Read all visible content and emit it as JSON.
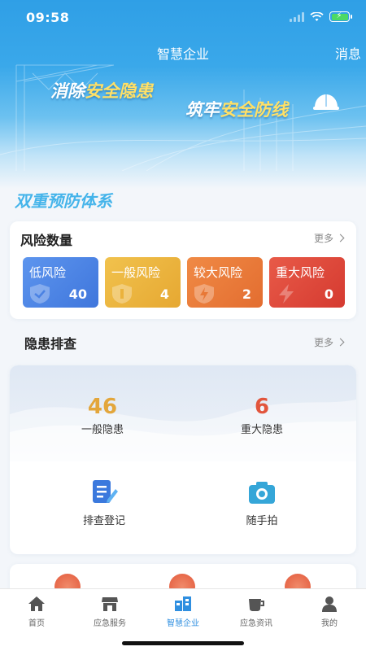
{
  "status_bar": {
    "time": "09:58"
  },
  "nav": {
    "title": "智慧企业",
    "message": "消息"
  },
  "banner": {
    "slogan1_prefix": "消除",
    "slogan1_highlight": "安全隐患",
    "slogan2_prefix": "筑牢",
    "slogan2_highlight": "安全防线"
  },
  "section_heading": "双重预防体系",
  "risk": {
    "title": "风险数量",
    "more": "更多",
    "tiles": [
      {
        "label": "低风险",
        "count": "40",
        "color": "#4f86e6",
        "icon": "shield-check-icon"
      },
      {
        "label": "一般风险",
        "count": "4",
        "color": "#edb63c",
        "icon": "shield-icon"
      },
      {
        "label": "较大风险",
        "count": "2",
        "color": "#ea7c3c",
        "icon": "lightning-shield-icon"
      },
      {
        "label": "重大风险",
        "count": "0",
        "color": "#e04a3c",
        "icon": "lightning-icon"
      }
    ]
  },
  "hazard": {
    "title": "隐患排查",
    "more": "更多",
    "general_count": "46",
    "general_label": "一般隐患",
    "major_count": "6",
    "major_label": "重大隐患",
    "actions": [
      {
        "label": "排查登记",
        "icon": "edit-document-icon"
      },
      {
        "label": "随手拍",
        "icon": "camera-icon"
      }
    ]
  },
  "tabs": [
    {
      "label": "首页",
      "icon": "home-icon"
    },
    {
      "label": "应急服务",
      "icon": "store-icon"
    },
    {
      "label": "智慧企业",
      "icon": "building-icon",
      "active": true
    },
    {
      "label": "应急资讯",
      "icon": "cup-icon"
    },
    {
      "label": "我的",
      "icon": "user-icon"
    }
  ]
}
